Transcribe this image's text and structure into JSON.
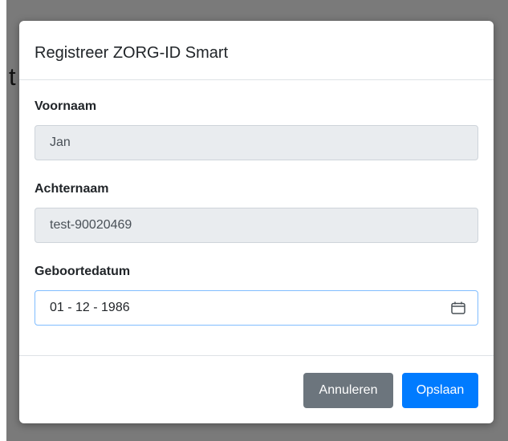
{
  "background": {
    "fragment_text": "t"
  },
  "modal": {
    "title": "Registreer ZORG-ID Smart",
    "fields": [
      {
        "label": "Voornaam",
        "value": "Jan",
        "readonly": true
      },
      {
        "label": "Achternaam",
        "value": "test-90020469",
        "readonly": true
      },
      {
        "label": "Geboortedatum",
        "value": "01 - 12 - 1986",
        "readonly": false,
        "icon": "calendar-icon"
      }
    ],
    "buttons": {
      "cancel_label": "Annuleren",
      "save_label": "Opslaan"
    }
  },
  "colors": {
    "primary": "#007bff",
    "secondary": "#6c757d",
    "readonly_bg": "#e9ecef",
    "focus_border": "#80bdff"
  }
}
